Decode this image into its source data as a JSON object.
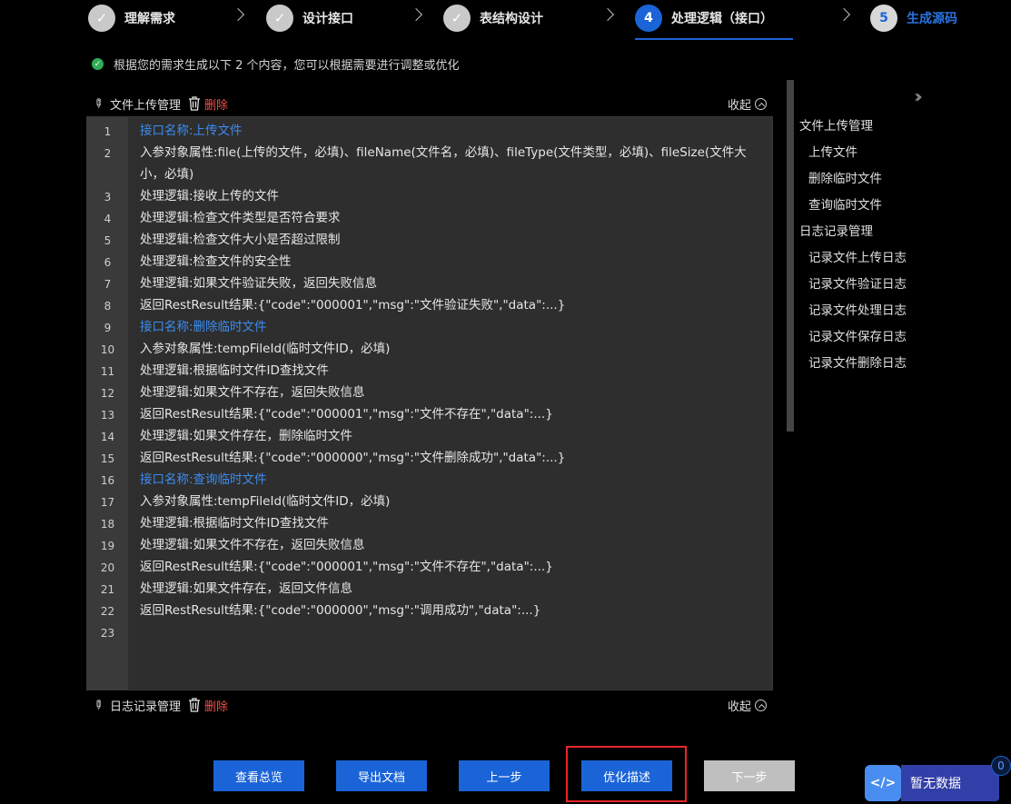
{
  "steps": [
    {
      "index": "✓",
      "label": "理解需求",
      "state": "done"
    },
    {
      "index": "✓",
      "label": "设计接口",
      "state": "done"
    },
    {
      "index": "✓",
      "label": "表结构设计",
      "state": "done"
    },
    {
      "index": "4",
      "label": "处理逻辑（接口）",
      "state": "active"
    },
    {
      "index": "5",
      "label": "生成源码",
      "state": "todo"
    }
  ],
  "notice": "根据您的需求生成以下 2 个内容，您可以根据需要进行调整或优化",
  "sections": [
    {
      "title": "文件上传管理",
      "delete_label": "删除",
      "collapse_label": "收起"
    },
    {
      "title": "日志记录管理",
      "delete_label": "删除",
      "collapse_label": "收起"
    }
  ],
  "code_lines": [
    {
      "n": "1",
      "text": "接口名称:上传文件",
      "blue": true
    },
    {
      "n": "2",
      "text": "入参对象属性:file(上传的文件，必填)、fileName(文件名，必填)、fileType(文件类型，必填)、fileSize(文件大小，必填)",
      "blue": false
    },
    {
      "n": "3",
      "text": "处理逻辑:接收上传的文件",
      "blue": false
    },
    {
      "n": "4",
      "text": "处理逻辑:检查文件类型是否符合要求",
      "blue": false
    },
    {
      "n": "5",
      "text": "处理逻辑:检查文件大小是否超过限制",
      "blue": false
    },
    {
      "n": "6",
      "text": "处理逻辑:检查文件的安全性",
      "blue": false
    },
    {
      "n": "7",
      "text": "处理逻辑:如果文件验证失败，返回失败信息",
      "blue": false
    },
    {
      "n": "8",
      "text": "返回RestResult结果:{\"code\":\"000001\",\"msg\":\"文件验证失败\",\"data\":...}",
      "blue": false
    },
    {
      "n": "9",
      "text": "接口名称:删除临时文件",
      "blue": true
    },
    {
      "n": "10",
      "text": "入参对象属性:tempFileId(临时文件ID，必填)",
      "blue": false
    },
    {
      "n": "11",
      "text": "处理逻辑:根据临时文件ID查找文件",
      "blue": false
    },
    {
      "n": "12",
      "text": "处理逻辑:如果文件不存在，返回失败信息",
      "blue": false
    },
    {
      "n": "13",
      "text": "返回RestResult结果:{\"code\":\"000001\",\"msg\":\"文件不存在\",\"data\":...}",
      "blue": false
    },
    {
      "n": "14",
      "text": "处理逻辑:如果文件存在，删除临时文件",
      "blue": false
    },
    {
      "n": "15",
      "text": "返回RestResult结果:{\"code\":\"000000\",\"msg\":\"文件删除成功\",\"data\":...}",
      "blue": false
    },
    {
      "n": "16",
      "text": "接口名称:查询临时文件",
      "blue": true
    },
    {
      "n": "17",
      "text": "入参对象属性:tempFileId(临时文件ID，必填)",
      "blue": false
    },
    {
      "n": "18",
      "text": "处理逻辑:根据临时文件ID查找文件",
      "blue": false
    },
    {
      "n": "19",
      "text": "处理逻辑:如果文件不存在，返回失败信息",
      "blue": false
    },
    {
      "n": "20",
      "text": "返回RestResult结果:{\"code\":\"000001\",\"msg\":\"文件不存在\",\"data\":...}",
      "blue": false
    },
    {
      "n": "21",
      "text": "处理逻辑:如果文件存在，返回文件信息",
      "blue": false
    },
    {
      "n": "22",
      "text": "返回RestResult结果:{\"code\":\"000000\",\"msg\":\"调用成功\",\"data\":...}",
      "blue": false
    },
    {
      "n": "23",
      "text": "",
      "blue": false
    }
  ],
  "outline": [
    {
      "label": "文件上传管理",
      "level": 0
    },
    {
      "label": "上传文件",
      "level": 1
    },
    {
      "label": "删除临时文件",
      "level": 1
    },
    {
      "label": "查询临时文件",
      "level": 1
    },
    {
      "label": "日志记录管理",
      "level": 0
    },
    {
      "label": "记录文件上传日志",
      "level": 1
    },
    {
      "label": "记录文件验证日志",
      "level": 1
    },
    {
      "label": "记录文件处理日志",
      "level": 1
    },
    {
      "label": "记录文件保存日志",
      "level": 1
    },
    {
      "label": "记录文件删除日志",
      "level": 1
    }
  ],
  "buttons": {
    "overview": "查看总览",
    "export": "导出文档",
    "prev": "上一步",
    "optimize": "优化描述",
    "next": "下一步"
  },
  "widget": {
    "code_icon": "</>",
    "label": "暂无数据",
    "badge": "0"
  },
  "colors": {
    "accent": "#1a64d8",
    "link_blue": "#3b8cf0",
    "danger": "#f0504a",
    "success": "#2fae56",
    "highlight": "#e8262b"
  }
}
